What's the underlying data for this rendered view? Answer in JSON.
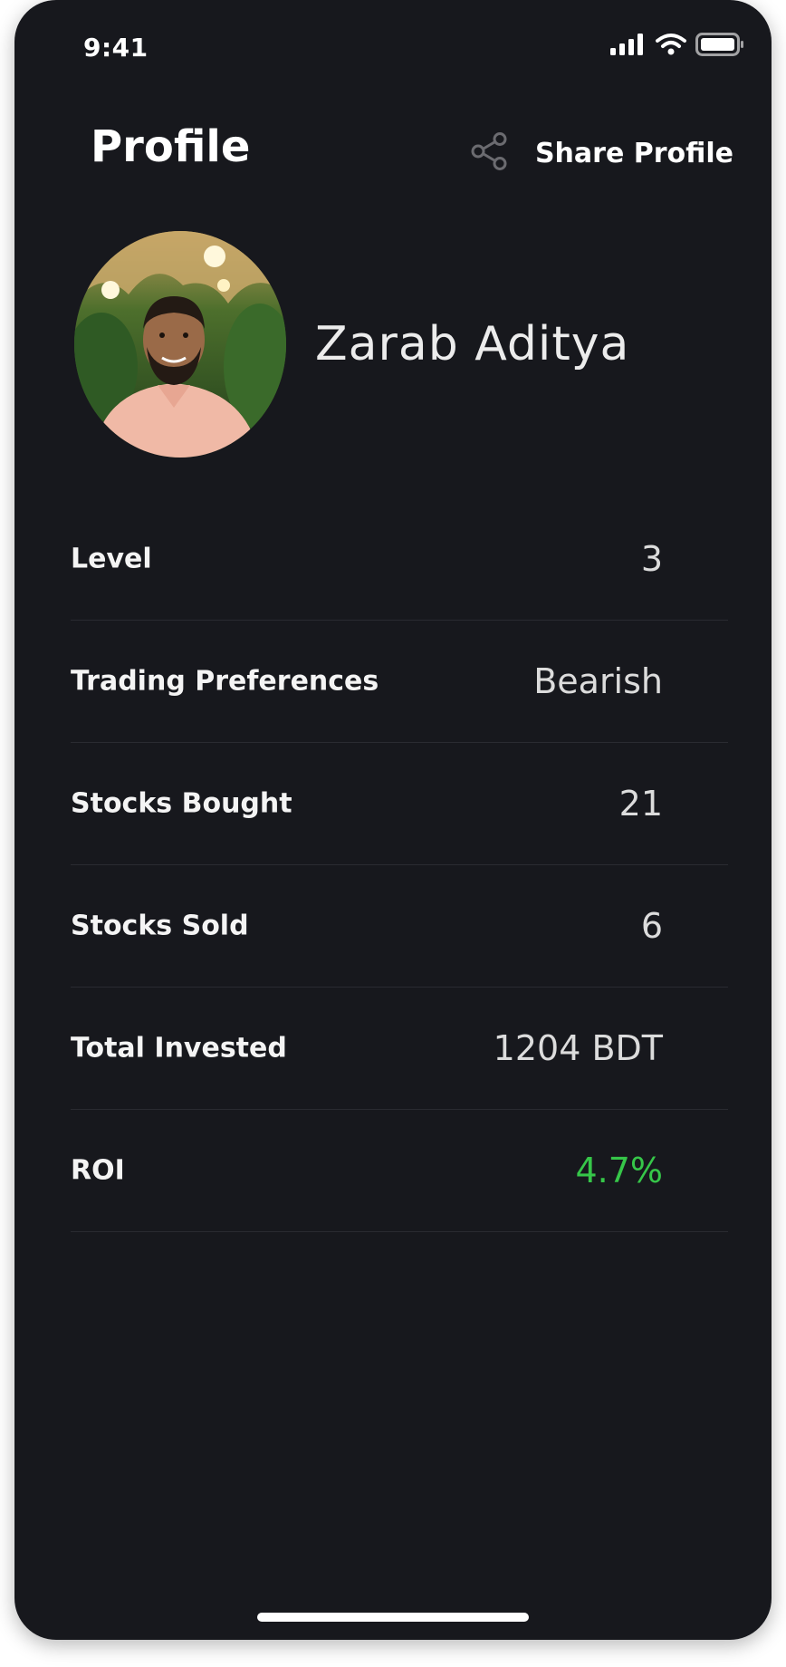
{
  "status_bar": {
    "time": "9:41",
    "icons": [
      "signal-icon",
      "wifi-icon",
      "battery-icon"
    ]
  },
  "header": {
    "title": "Profile",
    "share_icon": "share-icon",
    "share_label": "Share Profile"
  },
  "profile": {
    "name": "Zarab Aditya"
  },
  "stats": [
    {
      "label": "Level",
      "value": "3"
    },
    {
      "label": "Trading Preferences",
      "value": "Bearish"
    },
    {
      "label": "Stocks Bought",
      "value": "21"
    },
    {
      "label": "Stocks Sold",
      "value": "6"
    },
    {
      "label": "Total Invested",
      "value": "1204 BDT"
    },
    {
      "label": "ROI",
      "value": "4.7%"
    }
  ],
  "colors": {
    "background": "#17181d",
    "positive": "#36c649",
    "text": "#ffffff"
  }
}
